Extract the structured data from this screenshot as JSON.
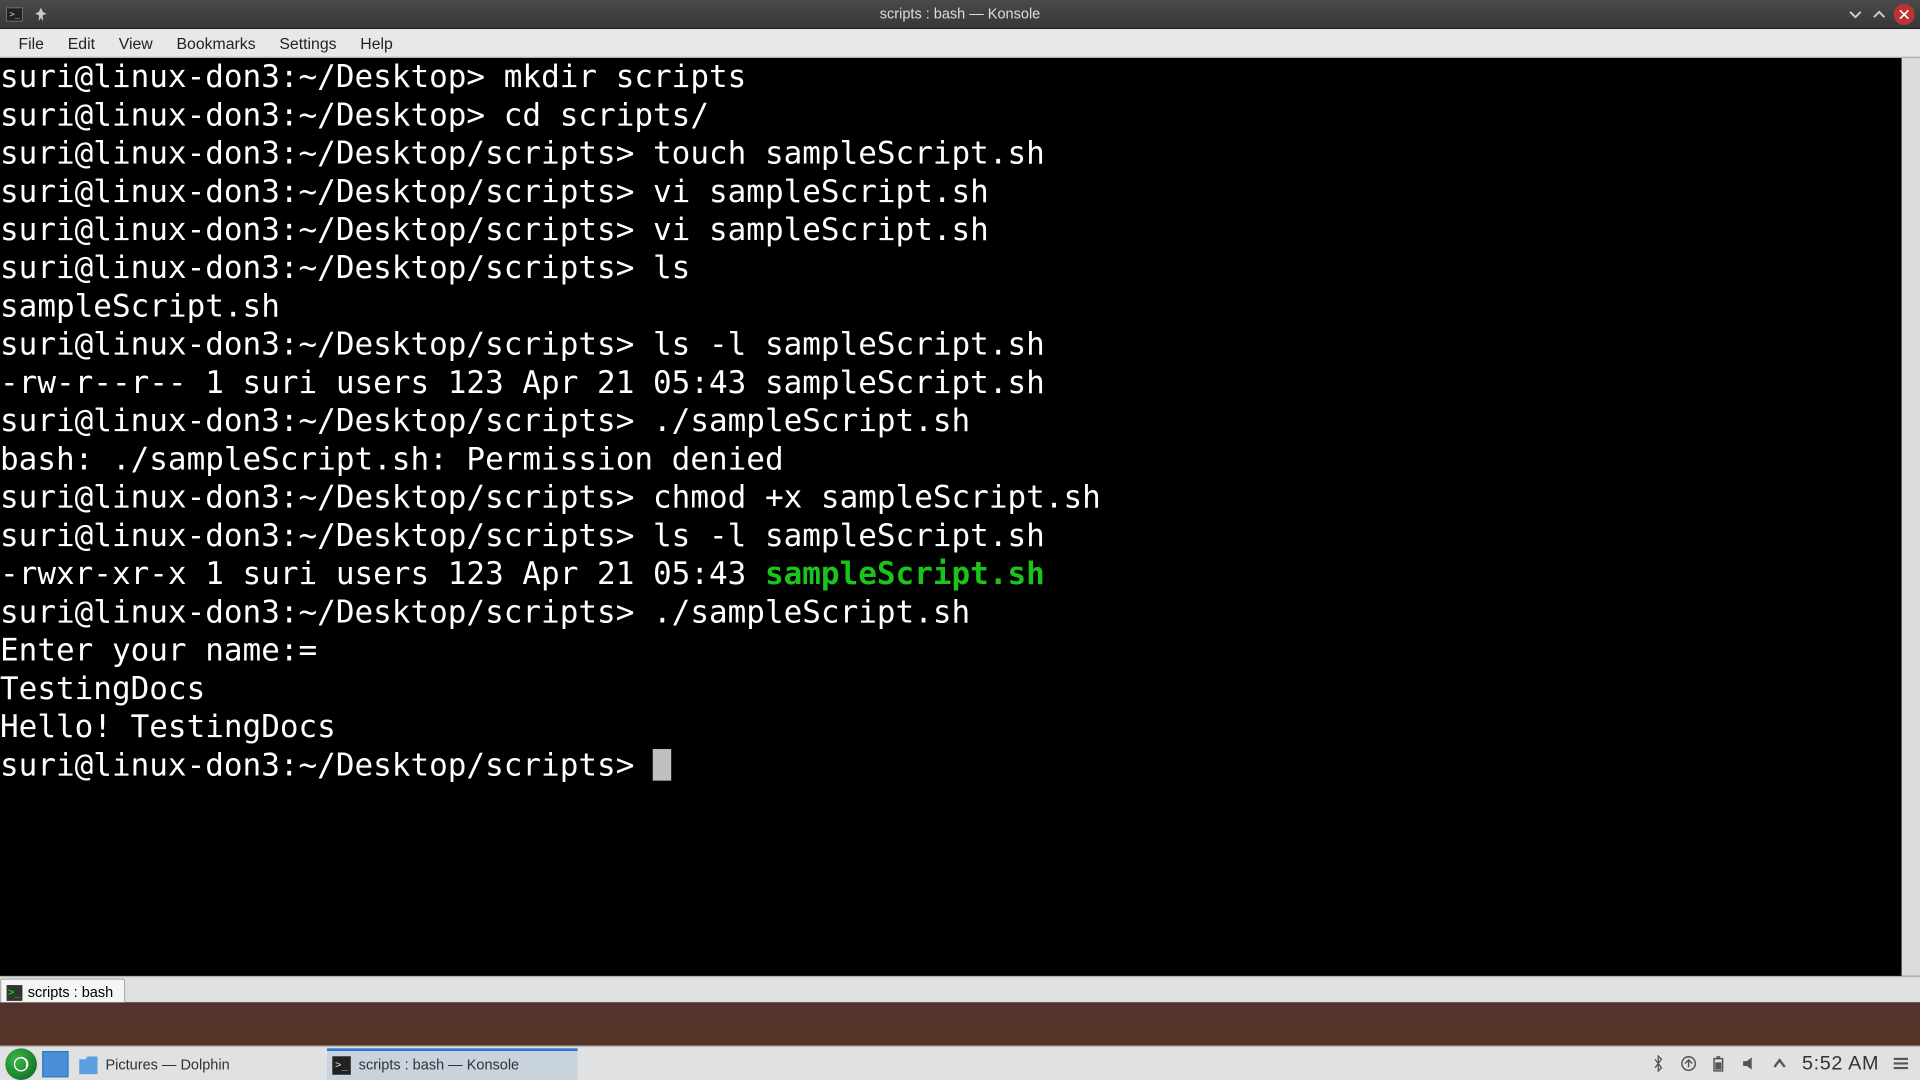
{
  "titlebar": {
    "title": "scripts : bash — Konsole"
  },
  "menubar": {
    "items": [
      "File",
      "Edit",
      "View",
      "Bookmarks",
      "Settings",
      "Help"
    ]
  },
  "terminal": {
    "prompt_desktop": "suri@linux-don3:~/Desktop> ",
    "prompt_scripts": "suri@linux-don3:~/Desktop/scripts> ",
    "lines": [
      {
        "prompt": "suri@linux-don3:~/Desktop> ",
        "cmd": "mkdir scripts"
      },
      {
        "prompt": "suri@linux-don3:~/Desktop> ",
        "cmd": "cd scripts/"
      },
      {
        "prompt": "suri@linux-don3:~/Desktop/scripts> ",
        "cmd": "touch sampleScript.sh"
      },
      {
        "prompt": "suri@linux-don3:~/Desktop/scripts> ",
        "cmd": "vi sampleScript.sh"
      },
      {
        "prompt": "suri@linux-don3:~/Desktop/scripts> ",
        "cmd": "vi sampleScript.sh"
      },
      {
        "prompt": "suri@linux-don3:~/Desktop/scripts> ",
        "cmd": "ls"
      },
      {
        "out": "sampleScript.sh"
      },
      {
        "prompt": "suri@linux-don3:~/Desktop/scripts> ",
        "cmd": "ls -l sampleScript.sh"
      },
      {
        "out": "-rw-r--r-- 1 suri users 123 Apr 21 05:43 sampleScript.sh"
      },
      {
        "prompt": "suri@linux-don3:~/Desktop/scripts> ",
        "cmd": "./sampleScript.sh"
      },
      {
        "out": "bash: ./sampleScript.sh: Permission denied"
      },
      {
        "prompt": "suri@linux-don3:~/Desktop/scripts> ",
        "cmd": "chmod +x sampleScript.sh"
      },
      {
        "prompt": "suri@linux-don3:~/Desktop/scripts> ",
        "cmd": "ls -l sampleScript.sh"
      },
      {
        "out_pre": "-rwxr-xr-x 1 suri users 123 Apr 21 05:43 ",
        "out_green": "sampleScript.sh"
      },
      {
        "prompt": "suri@linux-don3:~/Desktop/scripts> ",
        "cmd": "./sampleScript.sh"
      },
      {
        "out": "Enter your name:="
      },
      {
        "out": "TestingDocs"
      },
      {
        "out": "Hello! TestingDocs"
      },
      {
        "prompt": "suri@linux-don3:~/Desktop/scripts> ",
        "cursor": true
      }
    ]
  },
  "tab": {
    "label": "scripts : bash"
  },
  "taskbar": {
    "tasks": [
      {
        "label": "Pictures — Dolphin",
        "icon": "folder",
        "active": false
      },
      {
        "label": "scripts : bash — Konsole",
        "icon": "term",
        "active": true
      }
    ],
    "clock": "5:52 AM"
  }
}
